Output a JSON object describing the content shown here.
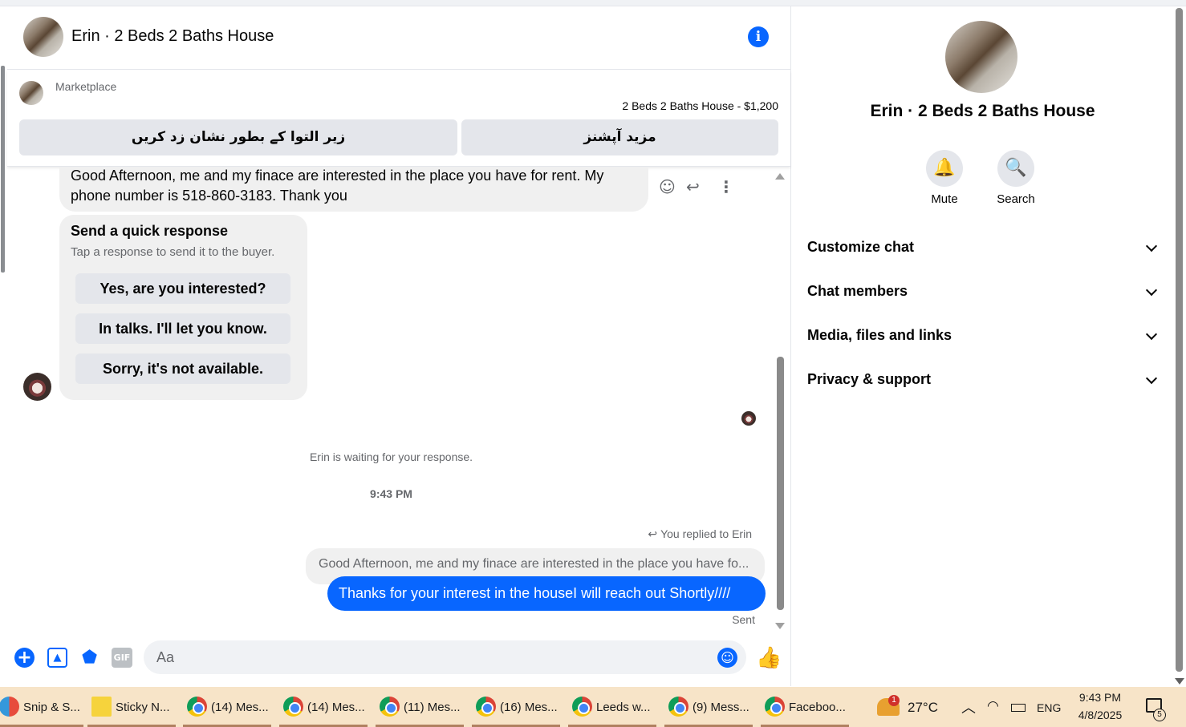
{
  "chat": {
    "title": "Erin · 2 Beds 2 Baths House",
    "info_icon": "info-icon"
  },
  "marketplace": {
    "label": "Marketplace",
    "listing": "2 Beds 2 Baths House - $1,200",
    "mark_pending_label": "زیر التوا کے بطور نشان زد کریں",
    "more_options_label": "مزید آپشنز"
  },
  "messages": {
    "incoming_text": "Good Afternoon, me and my finace are interested in the place you have for rent. My phone number is 518-860-3183. Thank you",
    "quick_response": {
      "title": "Send a quick response",
      "subtitle": "Tap a response to send it to the buyer.",
      "options": [
        "Yes, are you interested?",
        "In talks. I'll let you know.",
        "Sorry, it's not available."
      ]
    },
    "waiting_text": "Erin is waiting for your response.",
    "timestamp": "9:43 PM",
    "replied_text": "You replied to Erin",
    "quoted_text": "Good Afternoon, me and my finace are interested in the place you have fo...",
    "outgoing_text": "Thanks for your interest in the houseI will reach out Shortly////",
    "status": "Sent"
  },
  "composer": {
    "placeholder": "Aa",
    "gif_label": "GIF"
  },
  "info_panel": {
    "title": "Erin · 2 Beds 2 Baths House",
    "mute_label": "Mute",
    "search_label": "Search",
    "sections": [
      "Customize chat",
      "Chat members",
      "Media, files and links",
      "Privacy & support"
    ]
  },
  "taskbar": {
    "items": [
      {
        "label": "Snip & S...",
        "icon": "snip-icon"
      },
      {
        "label": "Sticky N...",
        "icon": "sticky-notes-icon"
      },
      {
        "label": "(14) Mes...",
        "icon": "chrome-icon"
      },
      {
        "label": "(14) Mes...",
        "icon": "chrome-icon"
      },
      {
        "label": "(11) Mes...",
        "icon": "chrome-icon"
      },
      {
        "label": "(16) Mes...",
        "icon": "chrome-icon"
      },
      {
        "label": "Leeds w...",
        "icon": "chrome-icon"
      },
      {
        "label": "(9) Mess...",
        "icon": "chrome-icon"
      },
      {
        "label": "Faceboo...",
        "icon": "chrome-icon"
      }
    ],
    "weather_badge": "1",
    "temperature": "27°C",
    "language": "ENG",
    "time": "9:43 PM",
    "date": "4/8/2025",
    "notification_count": "5"
  }
}
